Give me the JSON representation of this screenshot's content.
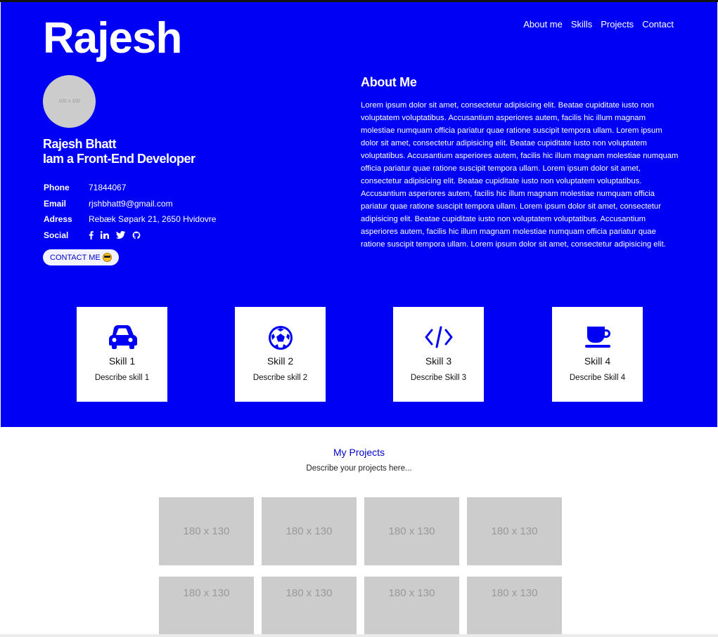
{
  "brand": "Rajesh",
  "nav": [
    "About me",
    "Skills",
    "Projects",
    "Contact"
  ],
  "avatar_text": "100 x 100",
  "profile": {
    "name": "Rajesh Bhatt",
    "role": "Iam a Front-End Developer",
    "phone_label": "Phone",
    "phone": "71844067",
    "email_label": "Email",
    "email": "rjshbhatt9@gmail.com",
    "address_label": "Adress",
    "address": "Rebæk Søpark 21, 2650 Hvidovre",
    "social_label": "Social",
    "social_icons": [
      "facebook-icon",
      "linkedin-icon",
      "twitter-icon",
      "github-icon"
    ]
  },
  "contact_button": "CONTACT ME",
  "about": {
    "title": "About Me",
    "text": "Lorem ipsum dolor sit amet, consectetur adipisicing elit. Beatae cupiditate iusto non voluptatem voluptatibus. Accusantium asperiores autem, facilis hic illum magnam molestiae numquam officia pariatur quae ratione suscipit tempora ullam. Lorem ipsum dolor sit amet, consectetur adipisicing elit. Beatae cupiditate iusto non voluptatem voluptatibus. Accusantium asperiores autem, facilis hic illum magnam molestiae numquam officia pariatur quae ratione suscipit tempora ullam. Lorem ipsum dolor sit amet, consectetur adipisicing elit. Beatae cupiditate iusto non voluptatem voluptatibus. Accusantium asperiores autem, facilis hic illum magnam molestiae numquam officia pariatur quae ratione suscipit tempora ullam. Lorem ipsum dolor sit amet, consectetur adipisicing elit. Beatae cupiditate iusto non voluptatem voluptatibus. Accusantium asperiores autem, facilis hic illum magnam molestiae numquam officia pariatur quae ratione suscipit tempora ullam. Lorem ipsum dolor sit amet, consectetur adipisicing elit."
  },
  "skills": [
    {
      "icon": "car-icon",
      "title": "Skill 1",
      "desc": "Describe skill 1"
    },
    {
      "icon": "soccer-ball-icon",
      "title": "Skill 2",
      "desc": "Describe skill 2"
    },
    {
      "icon": "code-icon",
      "title": "Skill 3",
      "desc": "Describe Skill 3"
    },
    {
      "icon": "coffee-cup-icon",
      "title": "Skill 4",
      "desc": "Describe Skill 4"
    }
  ],
  "projects": {
    "title": "My Projects",
    "desc": "Describe your projects here...",
    "thumb_label": "180 x 130"
  },
  "colors": {
    "hero_bg": "#0000f5",
    "accent": "#0000c8",
    "placeholder": "#cccccc"
  }
}
